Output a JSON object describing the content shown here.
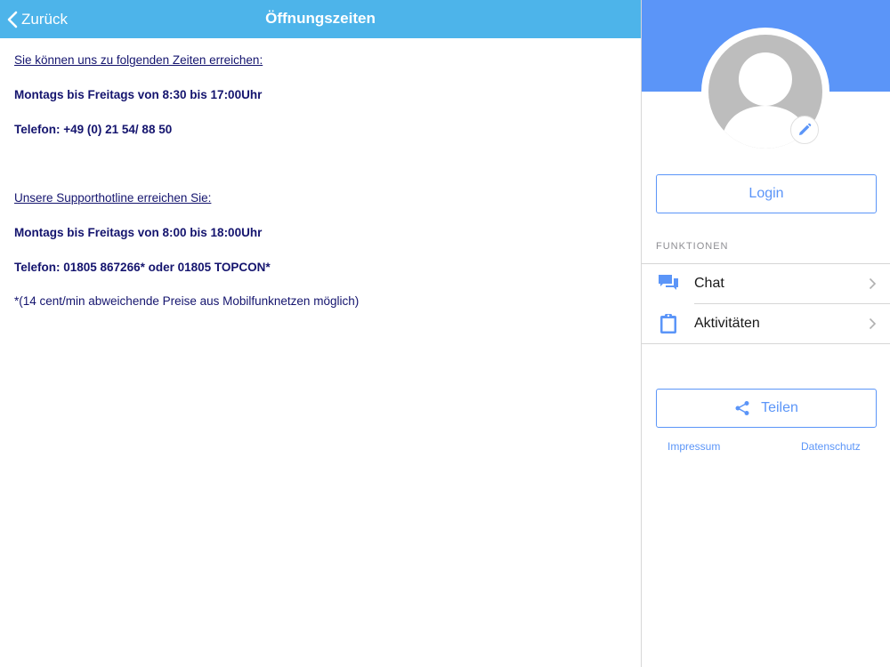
{
  "navbar": {
    "back_label": "Zurück",
    "title": "Öffnungszeiten"
  },
  "content": {
    "lines": [
      "Sie können uns zu folgenden Zeiten erreichen:",
      "Montags bis Freitags von 8:30 bis 17:00Uhr",
      "Telefon: +49 (0) 21 54/ 88 50",
      "Unsere Supporthotline erreichen Sie:",
      "Montags bis Freitags von 8:00 bis 18:00Uhr",
      "Telefon: 01805 867266* oder 01805 TOPCON*",
      "*(14 cent/min abweichende Preise aus Mobilfunknetzen möglich)"
    ]
  },
  "sidebar": {
    "login_label": "Login",
    "section_label": "FUNKTIONEN",
    "items": [
      {
        "label": "Chat",
        "icon": "chat-icon"
      },
      {
        "label": "Aktivitäten",
        "icon": "clipboard-icon"
      }
    ],
    "share_label": "Teilen",
    "footer": {
      "impressum": "Impressum",
      "datenschutz": "Datenschutz"
    }
  },
  "colors": {
    "navbar": "#4db4ea",
    "profile_header": "#5b95f8",
    "accent": "#5b95f8",
    "content_text": "#14146e"
  }
}
